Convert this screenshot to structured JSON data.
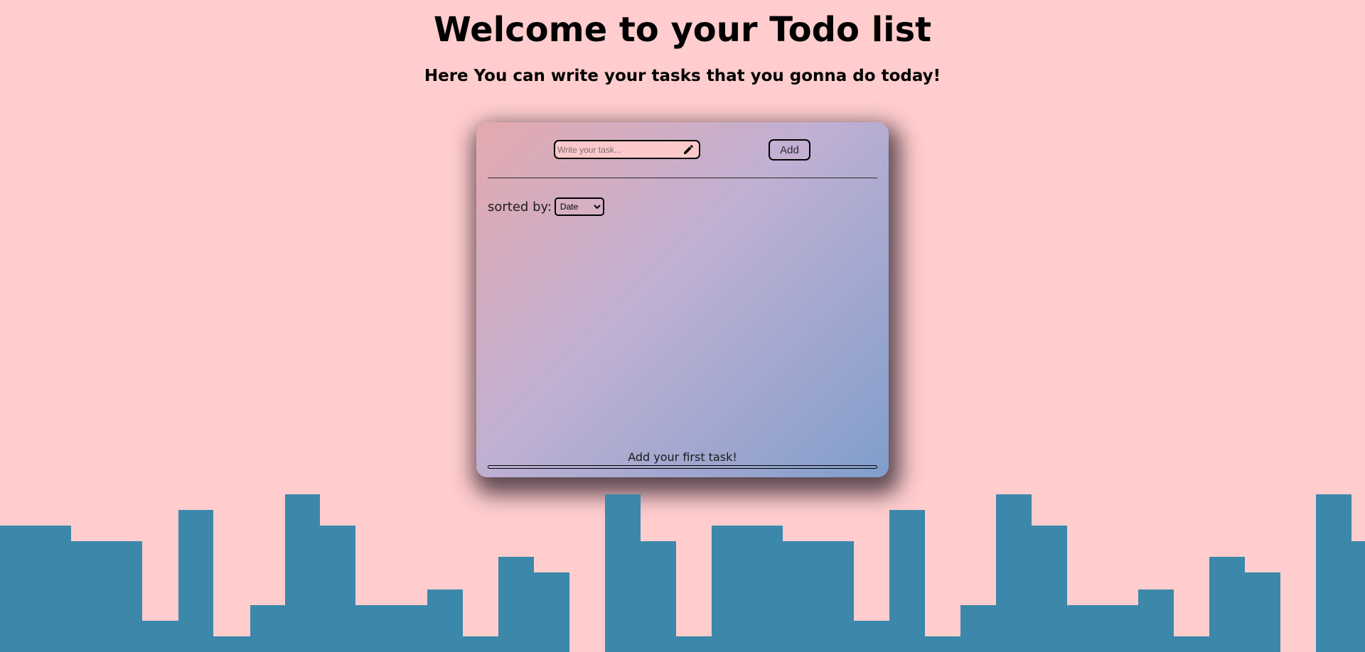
{
  "header": {
    "title": "Welcome to your Todo list",
    "subtitle": "Here You can write your tasks that you gonna do today!"
  },
  "todo": {
    "input_value": "",
    "input_placeholder": "Write your task...",
    "input_icon": "pencil-icon",
    "add_label": "Add",
    "sort_label": "sorted by:",
    "sort_selected": "Date",
    "empty_message": "Add your first task!",
    "progress": 0
  },
  "colors": {
    "background": "#ffcdce",
    "card_gradient_start": "#e4a9ae",
    "card_gradient_mid": "#c0b0d3",
    "card_gradient_end": "#809ecb",
    "skyline": "#3b88aa"
  }
}
